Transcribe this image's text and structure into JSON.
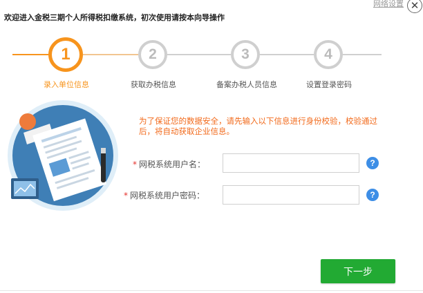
{
  "header": {
    "title": "欢迎进入金税三期个人所得税扣缴系统，初次使用请按本向导操作",
    "net_settings_label": "网络设置",
    "close_icon": "close-icon"
  },
  "steps": [
    {
      "number": "1",
      "label": "录入单位信息",
      "state": "active"
    },
    {
      "number": "2",
      "label": "获取办税信息",
      "state": "todo"
    },
    {
      "number": "3",
      "label": "备案办税人员信息",
      "state": "todo"
    },
    {
      "number": "4",
      "label": "设置登录密码",
      "state": "todo"
    }
  ],
  "notice": "为了保证您的数据安全，请先输入以下信息进行身份校验，校验通过后，将自动获取企业信息。",
  "form": {
    "required_mark": "*",
    "username_label": "网税系统用户名：",
    "username_value": "",
    "password_label": "网税系统用户密码：",
    "password_value": "",
    "help_icon": "?"
  },
  "next_button": "下一步",
  "colors": {
    "accent": "#f7941d",
    "step_inactive": "#cfcfcf",
    "notice": "#f26a1b",
    "help": "#3d8ee6",
    "button": "#22aa33",
    "required": "#e5322d"
  }
}
